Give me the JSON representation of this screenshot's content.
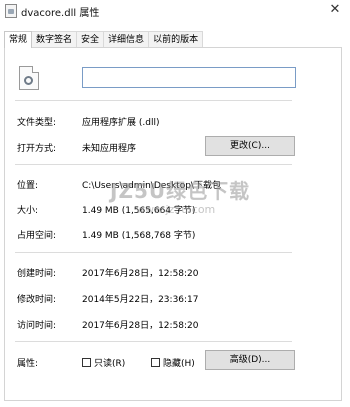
{
  "window": {
    "title": "dvacore.dll 属性",
    "close_glyph": "✕"
  },
  "tabs": [
    {
      "label": "常规",
      "active": true
    },
    {
      "label": "数字签名"
    },
    {
      "label": "安全"
    },
    {
      "label": "详细信息"
    },
    {
      "label": "以前的版本"
    }
  ],
  "general": {
    "file_type": {
      "label": "文件类型:",
      "value": "应用程序扩展 (.dll)"
    },
    "opens_with": {
      "label": "打开方式:",
      "value": "未知应用程序",
      "change_button": "更改(C)..."
    },
    "location": {
      "label": "位置:",
      "value": "C:\\Users\\admin\\Desktop\\下载包"
    },
    "size": {
      "label": "大小:",
      "value": "1.49 MB (1,565,664 字节)"
    },
    "size_on_disk": {
      "label": "占用空间:",
      "value": "1.49 MB (1,568,768 字节)"
    },
    "created": {
      "label": "创建时间:",
      "value": "2017年6月28日，12:58:20"
    },
    "modified": {
      "label": "修改时间:",
      "value": "2014年5月22日，23:36:17"
    },
    "accessed": {
      "label": "访问时间:",
      "value": "2017年6月28日，12:58:20"
    },
    "attributes": {
      "label": "属性:",
      "readonly": "只读(R)",
      "hidden": "隐藏(H)",
      "advanced_button": "高级(D)..."
    }
  },
  "watermark": {
    "line1": "JZ5U绿色下载",
    "line2": "www.jz5u.com"
  }
}
